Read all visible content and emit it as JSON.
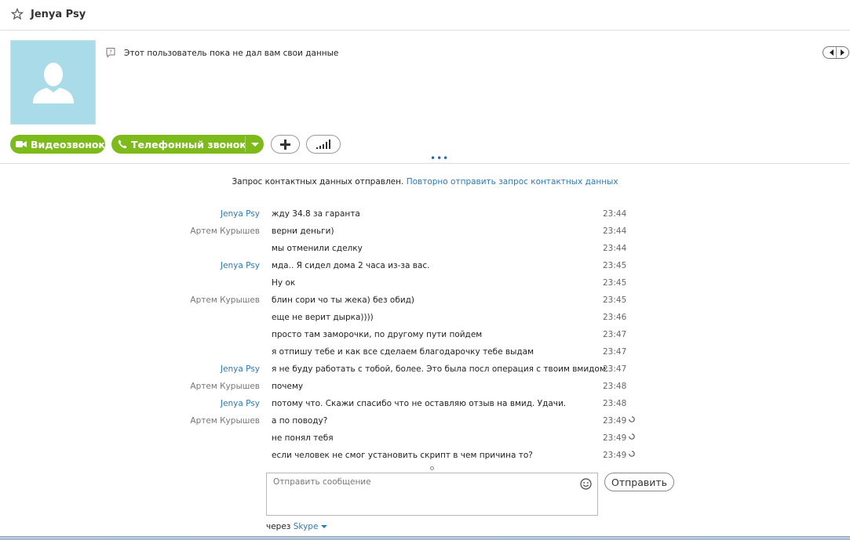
{
  "header": {
    "contact_name": "Jenya Psy",
    "star_icon": "star-outline-icon"
  },
  "profile": {
    "info_icon": "question-bubble-icon",
    "info_text": "Этот пользователь пока не дал вам свои данные",
    "avatar_icon": "default-user-silhouette-icon",
    "avatar_color": "#aadbe9"
  },
  "actions": {
    "video_call_label": "Видеозвонок",
    "phone_call_label": "Телефонный звонок",
    "accent_color": "#7dbb1a",
    "add_icon": "plus-icon",
    "signal_icon": "signal-bars-icon"
  },
  "notice": {
    "text": "Запрос контактных данных отправлен.",
    "link": "Повторно отправить запрос контактных данных"
  },
  "messages": [
    {
      "sender": "Jenya Psy",
      "text": "жду 34.8 за гаранта",
      "time": "23:44",
      "pending": false
    },
    {
      "sender": "Артем Курышев",
      "text": "верни деньги)",
      "time": "23:44",
      "pending": false
    },
    {
      "sender": "",
      "text": "мы отменили сделку",
      "time": "23:44",
      "pending": false
    },
    {
      "sender": "Jenya Psy",
      "text": "мда.. Я сидел дома 2 часа из-за вас.",
      "time": "23:45",
      "pending": false
    },
    {
      "sender": "",
      "text": "Ну ок",
      "time": "23:45",
      "pending": false
    },
    {
      "sender": "Артем Курышев",
      "text": "блин сори чо ты жека) без обид)",
      "time": "23:45",
      "pending": false
    },
    {
      "sender": "",
      "text": "еще не верит дырка))))",
      "time": "23:46",
      "pending": false
    },
    {
      "sender": "",
      "text": "просто там заморочки, по другому пути пойдем",
      "time": "23:47",
      "pending": false
    },
    {
      "sender": "",
      "text": "я отпишу тебе и как все сделаем благодарочку тебе выдам",
      "time": "23:47",
      "pending": false
    },
    {
      "sender": "Jenya Psy",
      "text": "я не буду работать с тобой, более. Это была посл операция с твоим вмидом.",
      "time": "23:47",
      "pending": false
    },
    {
      "sender": "Артем Курышев",
      "text": "почему",
      "time": "23:48",
      "pending": false
    },
    {
      "sender": "Jenya Psy",
      "text": "потому что. Скажи спасибо что не оставляю отзыв на вмид. Удачи.",
      "time": "23:48",
      "pending": false
    },
    {
      "sender": "Артем Курышев",
      "text": "а по поводу?",
      "time": "23:49",
      "pending": true
    },
    {
      "sender": "",
      "text": "не понял тебя",
      "time": "23:49",
      "pending": true
    },
    {
      "sender": "",
      "text": "если человек не смог установить скрипт в чем причина то?",
      "time": "23:49",
      "pending": true
    }
  ],
  "composer": {
    "placeholder": "Отправить сообщение",
    "send_label": "Отправить",
    "emoji_icon": "smiley-icon",
    "via_label": "через",
    "via_service": "Skype"
  }
}
